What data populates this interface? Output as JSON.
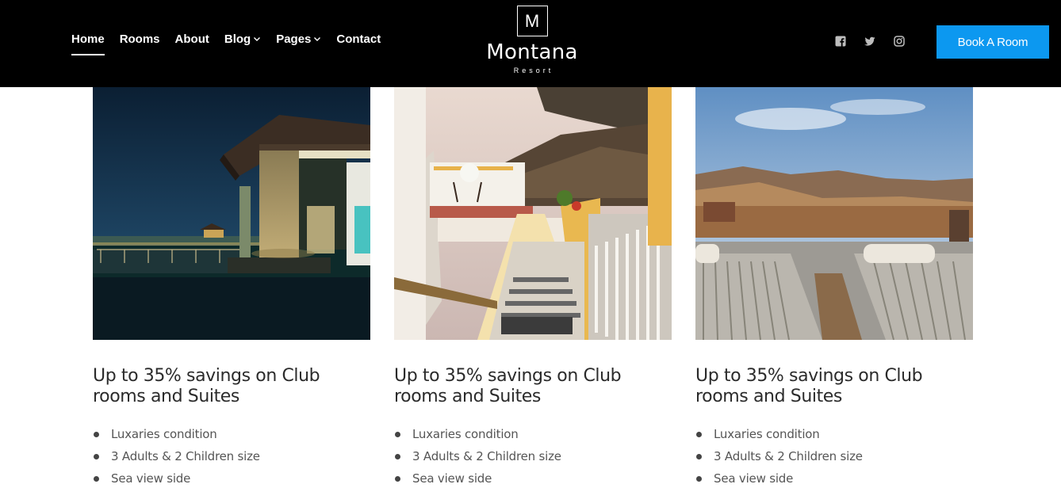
{
  "nav": {
    "items": [
      {
        "label": "Home",
        "active": true,
        "dropdown": false
      },
      {
        "label": "Rooms",
        "active": false,
        "dropdown": false
      },
      {
        "label": "About",
        "active": false,
        "dropdown": false
      },
      {
        "label": "Blog",
        "active": false,
        "dropdown": true
      },
      {
        "label": "Pages",
        "active": false,
        "dropdown": true
      },
      {
        "label": "Contact",
        "active": false,
        "dropdown": false
      }
    ]
  },
  "logo": {
    "letter": "M",
    "name": "Montana",
    "subtitle": "Resort"
  },
  "social": {
    "icons": [
      "facebook-icon",
      "twitter-icon",
      "instagram-icon"
    ]
  },
  "cta": {
    "book_label": "Book A Room",
    "color": "#0c98f0"
  },
  "cards": [
    {
      "image": "night-villa-photo",
      "title": "Up to 35% savings on Club rooms and Suites",
      "features": [
        "Luxaries condition",
        "3 Adults & 2 Children size",
        "Sea view side"
      ]
    },
    {
      "image": "santorini-stairs-photo",
      "title": "Up to 35% savings on Club rooms and Suites",
      "features": [
        "Luxaries condition",
        "3 Adults & 2 Children size",
        "Sea view side"
      ]
    },
    {
      "image": "mountain-loungers-photo",
      "title": "Up to 35% savings on Club rooms and Suites",
      "features": [
        "Luxaries condition",
        "3 Adults & 2 Children size",
        "Sea view side"
      ]
    }
  ]
}
